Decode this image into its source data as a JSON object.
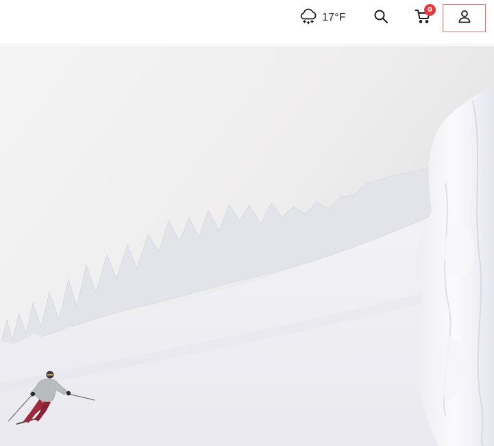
{
  "header": {
    "weather": {
      "icon": "snow-cloud-icon",
      "temperature": "17°F"
    },
    "search": {
      "icon": "search-icon"
    },
    "cart": {
      "icon": "cart-icon",
      "count": "0",
      "badge_color": "#e5383b"
    },
    "account": {
      "icon": "user-icon",
      "highlight_color": "#e07a7a"
    }
  },
  "hero": {
    "scene": "skier-on-snowy-slope"
  }
}
